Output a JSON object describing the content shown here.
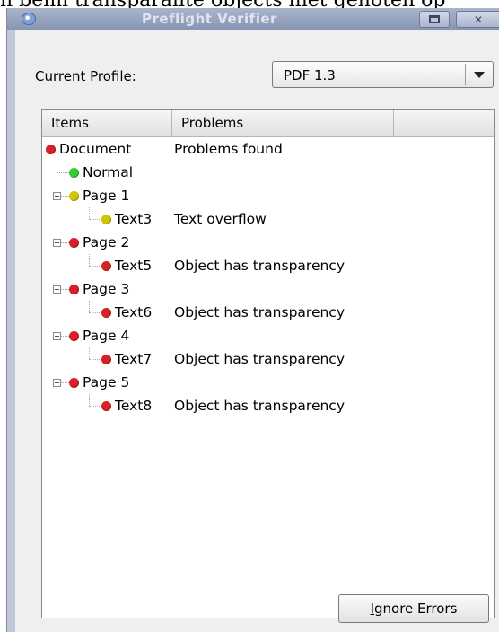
{
  "background_text": "n beim transparante objects niet genoten op",
  "window": {
    "title": "Preflight Verifier",
    "colors": {
      "titlebar": "#8795b3",
      "panel": "#efefef",
      "red": "#d9202a",
      "green": "#33cc33",
      "yellow": "#d4c400"
    }
  },
  "profile": {
    "label": "Current Profile:",
    "selected": "PDF 1.3"
  },
  "tree": {
    "columns": [
      "Items",
      "Problems"
    ],
    "rows": [
      {
        "item": "Document",
        "problem": "Problems found",
        "status": "red",
        "level": 0
      },
      {
        "item": "Normal",
        "problem": "",
        "status": "green",
        "level": 1
      },
      {
        "item": "Page 1",
        "problem": "",
        "status": "yellow",
        "level": 1,
        "expanded": true
      },
      {
        "item": "Text3",
        "problem": "Text overflow",
        "status": "yellow",
        "level": 2
      },
      {
        "item": "Page 2",
        "problem": "",
        "status": "red",
        "level": 1,
        "expanded": true
      },
      {
        "item": "Text5",
        "problem": "Object has transparency",
        "status": "red",
        "level": 2
      },
      {
        "item": "Page 3",
        "problem": "",
        "status": "red",
        "level": 1,
        "expanded": true
      },
      {
        "item": "Text6",
        "problem": "Object has transparency",
        "status": "red",
        "level": 2
      },
      {
        "item": "Page 4",
        "problem": "",
        "status": "red",
        "level": 1,
        "expanded": true
      },
      {
        "item": "Text7",
        "problem": "Object has transparency",
        "status": "red",
        "level": 2
      },
      {
        "item": "Page 5",
        "problem": "",
        "status": "red",
        "level": 1,
        "expanded": true
      },
      {
        "item": "Text8",
        "problem": "Object has transparency",
        "status": "red",
        "level": 2
      }
    ]
  },
  "buttons": {
    "ignore_mnemonic": "I",
    "ignore_rest": "gnore Errors"
  },
  "icons": {
    "app": "app-icon",
    "maximize": "maximize-icon",
    "close": "close-icon",
    "dropdown": "chevron-down-icon",
    "expander": "collapse-icon",
    "status": "status-bullet-icon"
  }
}
